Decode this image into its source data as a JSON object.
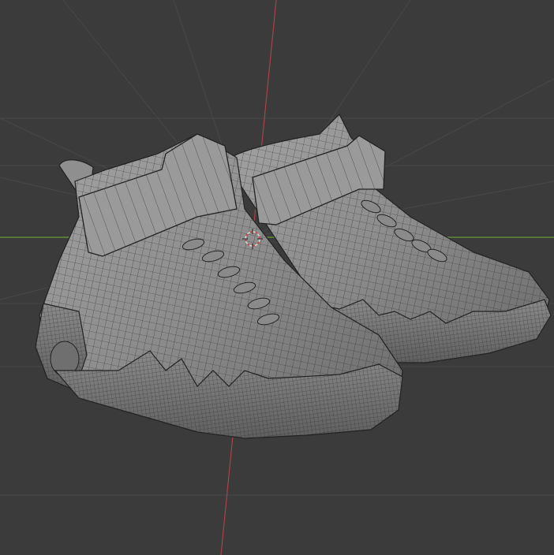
{
  "viewport": {
    "background": "#3b3b3b",
    "grid_color": "#4a4a4a",
    "x_axis_color": "#6f9a3a",
    "y_axis_color": "#a8434c",
    "mesh_fill": "#8f8f8f",
    "mesh_shade": "#6e6e6e",
    "wire_color": "#2a2a2a"
  },
  "scene": {
    "object": "sneaker-pair-mesh",
    "cursor": "3d-cursor-icon",
    "view": "perspective",
    "shading": "solid-wireframe"
  }
}
